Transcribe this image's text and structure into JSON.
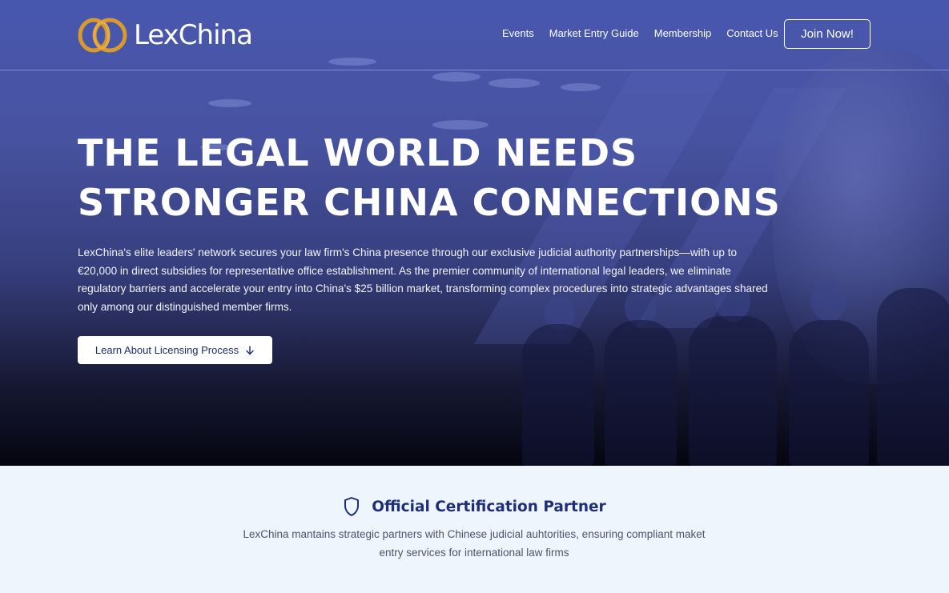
{
  "brand": {
    "name": "LexChina",
    "logo_ring_color": "#d89a2e"
  },
  "nav": {
    "links": [
      {
        "label": "Events"
      },
      {
        "label": "Market Entry Guide"
      },
      {
        "label": "Membership"
      },
      {
        "label": "Contact Us"
      }
    ],
    "join_label": "Join Now!"
  },
  "hero": {
    "headline_line1": "THE LEGAL WORLD NEEDS",
    "headline_line2": "STRONGER CHINA CONNECTIONS",
    "description": "LexChina's elite leaders' network secures your law firm's China presence through our exclusive judicial authority partnerships—with up to €20,000 in direct subsidies for representative office establishment. As the premier community of international legal leaders, we eliminate regulatory barriers and accelerate your entry into China's $25 billion market, transforming complex procedures into strategic advantages shared only among our distinguished member firms.",
    "cta_label": "Learn About Licensing Process",
    "cta_icon": "arrow-down-icon"
  },
  "certification": {
    "icon": "shield-icon",
    "title": "Official Certification Partner",
    "description": "LexChina mantains strategic partners with Chinese judicial auhtorities, ensuring compliant maket entry services for international law firms"
  },
  "colors": {
    "hero_overlay": "#3a4aa8",
    "accent_navy": "#1e2e78",
    "section_bg": "#eef5fc"
  }
}
